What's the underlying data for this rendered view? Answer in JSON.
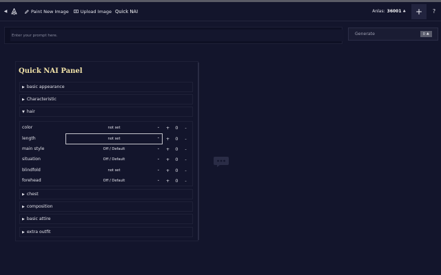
{
  "topbar": {
    "nav": [
      {
        "label": "Paint New Image",
        "icon": "pencil-icon"
      },
      {
        "label": "Upload Image",
        "icon": "upload-icon"
      }
    ],
    "title": "Quick NAI",
    "anlas_label": "Anlas:",
    "anlas_value": "36001",
    "plus_label": "+",
    "help_label": "?"
  },
  "prompt": {
    "placeholder": "Enter your prompt here."
  },
  "generate": {
    "label": "Generate",
    "cost": "0"
  },
  "panel": {
    "title": "Quick NAI Panel",
    "sections_top": [
      {
        "label": "basic appearance",
        "expanded": false
      },
      {
        "label": "Characteristic",
        "expanded": false
      },
      {
        "label": "hair",
        "expanded": true
      }
    ],
    "hair_rows": [
      {
        "label": "color",
        "value": "not set",
        "count": "0"
      },
      {
        "label": "length",
        "value": "not set",
        "count": "0"
      },
      {
        "label": "main style",
        "value": "Off / Default",
        "count": "0"
      },
      {
        "label": "situation",
        "value": "Off / Default",
        "count": "0"
      },
      {
        "label": "blindfold",
        "value": "not set",
        "count": "0"
      },
      {
        "label": "forehead",
        "value": "Off / Default",
        "count": "0"
      }
    ],
    "sections_bottom": [
      {
        "label": "chest",
        "expanded": false
      },
      {
        "label": "composition",
        "expanded": false
      },
      {
        "label": "basic attire",
        "expanded": false
      },
      {
        "label": "extra outfit",
        "expanded": false
      }
    ],
    "plus_label": "+",
    "minus_label": "-"
  },
  "colors": {
    "background": "#13152c",
    "panel_title": "#f2e3a8",
    "accent_button": "#22243f"
  }
}
